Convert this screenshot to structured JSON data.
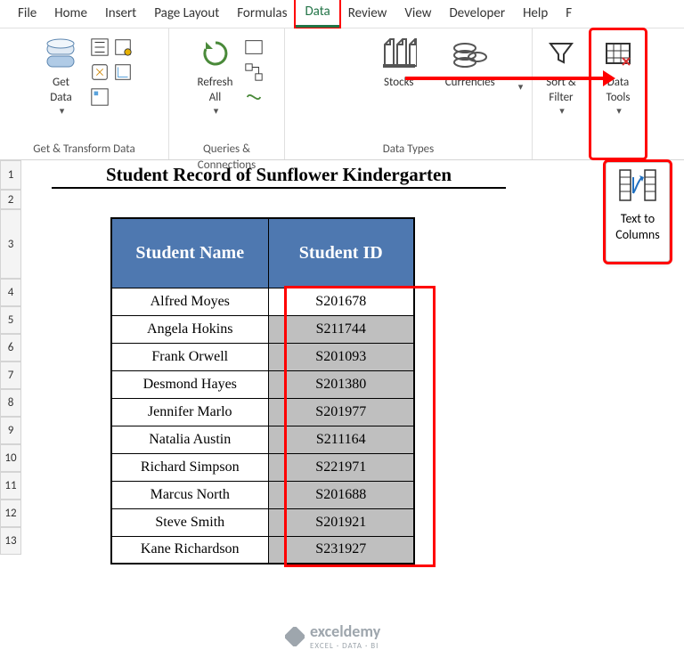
{
  "menu": [
    "File",
    "Home",
    "Insert",
    "Page Layout",
    "Formulas",
    "Data",
    "Review",
    "View",
    "Developer",
    "Help",
    "F"
  ],
  "active_menu": "Data",
  "ribbon": {
    "group1": {
      "label": "Get & Transform Data",
      "getdata": "Get\nData"
    },
    "group2": {
      "label": "Queries & Connections",
      "refresh": "Refresh\nAll"
    },
    "group3": {
      "label": "Data Types",
      "stocks": "Stocks",
      "currencies": "Currencies"
    },
    "sortfilter": "Sort &\nFilter",
    "tools": "Data\nTools"
  },
  "floating": "Text to\nColumns",
  "title": "Student Record of Sunflower Kindergarten",
  "headers": {
    "name": "Student Name",
    "id": "Student ID"
  },
  "rows": [
    {
      "name": "Alfred Moyes",
      "id": "S201678"
    },
    {
      "name": "Angela Hokins",
      "id": "S211744"
    },
    {
      "name": "Frank Orwell",
      "id": "S201093"
    },
    {
      "name": "Desmond Hayes",
      "id": "S201380"
    },
    {
      "name": "Jennifer Marlo",
      "id": "S201977"
    },
    {
      "name": "Natalia Austin",
      "id": "S211164"
    },
    {
      "name": "Richard Simpson",
      "id": "S221971"
    },
    {
      "name": "Marcus North",
      "id": "S201688"
    },
    {
      "name": "Steve Smith",
      "id": "S201921"
    },
    {
      "name": "Kane Richardson",
      "id": "S231927"
    }
  ],
  "rownums": [
    "1",
    "2",
    "3",
    "4",
    "5",
    "6",
    "7",
    "8",
    "9",
    "10",
    "11",
    "12",
    "13"
  ],
  "watermark": {
    "brand": "exceldemy",
    "sub": "EXCEL · DATA · BI"
  }
}
